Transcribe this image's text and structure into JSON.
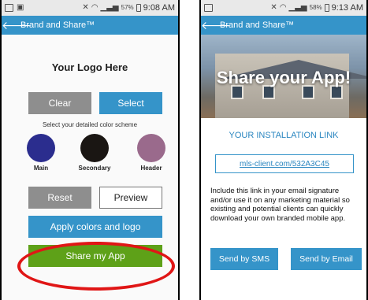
{
  "left": {
    "status": {
      "battery_pct": "57%",
      "time": "9:08 AM"
    },
    "appbar": {
      "title": "Brand and Share™"
    },
    "logo_text": "Your Logo Here",
    "clear_label": "Clear",
    "select_label": "Select",
    "scheme_label": "Select your detailed color scheme",
    "swatches": [
      {
        "label": "Main",
        "color": "#2b2d8e"
      },
      {
        "label": "Secondary",
        "color": "#1a1613"
      },
      {
        "label": "Header",
        "color": "#9a6a8c"
      }
    ],
    "reset_label": "Reset",
    "preview_label": "Preview",
    "apply_label": "Apply colors and logo",
    "share_label": "Share my App"
  },
  "right": {
    "status": {
      "battery_pct": "58%",
      "time": "9:13 AM"
    },
    "appbar": {
      "title": "Brand and Share™"
    },
    "banner_text": "Share your App!",
    "install_title": "YOUR INSTALLATION LINK",
    "link": "mls-client.com/532A3C45",
    "description": "Include this link in your email signature and/or use it on any marketing material so existing and potential clients can quickly download your own branded mobile app.",
    "sms_label": "Send by SMS",
    "email_label": "Send by Email"
  },
  "colors": {
    "accent": "#3594c9",
    "green": "#5ea118",
    "gray": "#8e8e8e",
    "highlight": "#e01616"
  }
}
